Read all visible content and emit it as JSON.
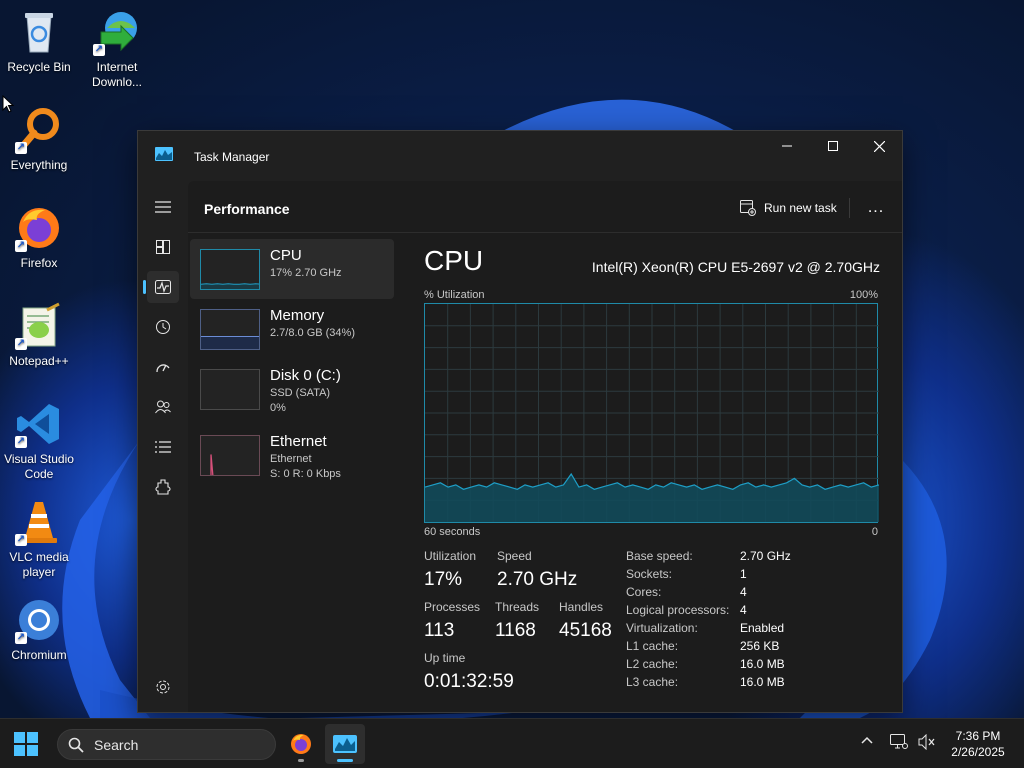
{
  "desktop": {
    "icons": [
      {
        "label": "Recycle Bin",
        "icon": "recycle-bin-icon",
        "shortcut": false
      },
      {
        "label": "Internet Downlo...",
        "icon": "internet-download-manager-icon",
        "shortcut": true
      },
      {
        "label": "Everything",
        "icon": "everything-search-icon",
        "shortcut": true
      },
      {
        "label": "Firefox",
        "icon": "firefox-icon",
        "shortcut": true
      },
      {
        "label": "Notepad++",
        "icon": "notepad-plus-plus-icon",
        "shortcut": true
      },
      {
        "label": "Visual Studio Code",
        "icon": "vscode-icon",
        "shortcut": true
      },
      {
        "label": "VLC media player",
        "icon": "vlc-icon",
        "shortcut": true
      },
      {
        "label": "Chromium",
        "icon": "chromium-icon",
        "shortcut": true
      }
    ]
  },
  "window": {
    "title": "Task Manager",
    "buttons": {
      "minimize": "minimize-icon",
      "maximize": "maximize-icon",
      "close": "close-icon"
    }
  },
  "nav": {
    "items": [
      {
        "icon": "hamburger-menu-icon"
      },
      {
        "icon": "processes-icon"
      },
      {
        "icon": "performance-icon",
        "active": true
      },
      {
        "icon": "app-history-icon"
      },
      {
        "icon": "startup-apps-icon"
      },
      {
        "icon": "users-icon"
      },
      {
        "icon": "details-icon"
      },
      {
        "icon": "services-icon"
      },
      {
        "icon": "settings-icon"
      }
    ]
  },
  "header": {
    "title": "Performance",
    "run_new_task": "Run new task",
    "more": "..."
  },
  "resources": [
    {
      "name": "CPU",
      "line1": "17% 2.70 GHz",
      "line2": "",
      "active": true
    },
    {
      "name": "Memory",
      "line1": "2.7/8.0 GB (34%)",
      "line2": ""
    },
    {
      "name": "Disk 0 (C:)",
      "line1": "SSD (SATA)",
      "line2": "0%"
    },
    {
      "name": "Ethernet",
      "line1": "Ethernet",
      "line2": "S: 0 R: 0 Kbps"
    }
  ],
  "cpu": {
    "title": "CPU",
    "model": "Intel(R) Xeon(R) CPU E5-2697 v2 @ 2.70GHz",
    "graph_label_left": "% Utilization",
    "graph_label_right": "100%",
    "axis_left": "60 seconds",
    "axis_right": "0",
    "stats": {
      "utilization_label": "Utilization",
      "utilization": "17%",
      "speed_label": "Speed",
      "speed": "2.70 GHz",
      "processes_label": "Processes",
      "processes": "113",
      "threads_label": "Threads",
      "threads": "1168",
      "handles_label": "Handles",
      "handles": "45168",
      "uptime_label": "Up time",
      "uptime": "0:01:32:59"
    },
    "specs": [
      {
        "key": "Base speed:",
        "value": "2.70 GHz"
      },
      {
        "key": "Sockets:",
        "value": "1"
      },
      {
        "key": "Cores:",
        "value": "4"
      },
      {
        "key": "Logical processors:",
        "value": "4"
      },
      {
        "key": "Virtualization:",
        "value": "Enabled"
      },
      {
        "key": "L1 cache:",
        "value": "256 KB"
      },
      {
        "key": "L2 cache:",
        "value": "16.0 MB"
      },
      {
        "key": "L3 cache:",
        "value": "16.0 MB"
      }
    ],
    "history_percent": [
      16,
      17,
      18,
      16,
      17,
      15,
      16,
      17,
      16,
      18,
      17,
      16,
      15,
      17,
      16,
      17,
      18,
      16,
      17,
      22,
      16,
      17,
      15,
      16,
      17,
      18,
      16,
      17,
      16,
      15,
      17,
      16,
      18,
      17,
      16,
      17,
      15,
      16,
      17,
      16,
      15,
      17,
      18,
      16,
      17,
      16,
      17,
      18,
      20,
      17,
      16,
      17,
      15,
      16,
      17,
      16,
      17,
      18,
      16,
      17
    ]
  },
  "mini_graphs": {
    "cpu_percent": [
      2,
      3,
      2,
      3,
      2,
      3,
      2,
      2,
      3,
      2,
      3,
      2
    ],
    "memory_percent": 34,
    "ethernet_spike": 55
  },
  "colors": {
    "cpu_line": "#1e9ec6",
    "cpu_fill": "#124a5a",
    "memory": "#6b8cd6",
    "ethernet": "#d6507a",
    "accent": "#4cc2ff"
  },
  "taskbar": {
    "search_placeholder": "Search",
    "apps": [
      {
        "icon": "firefox-icon"
      },
      {
        "icon": "task-manager-icon",
        "active": true
      }
    ],
    "tray": [
      {
        "icon": "chevron-up-icon"
      },
      {
        "icon": "network-icon"
      },
      {
        "icon": "volume-muted-icon"
      }
    ],
    "time": "7:36 PM",
    "date": "2/26/2025"
  }
}
